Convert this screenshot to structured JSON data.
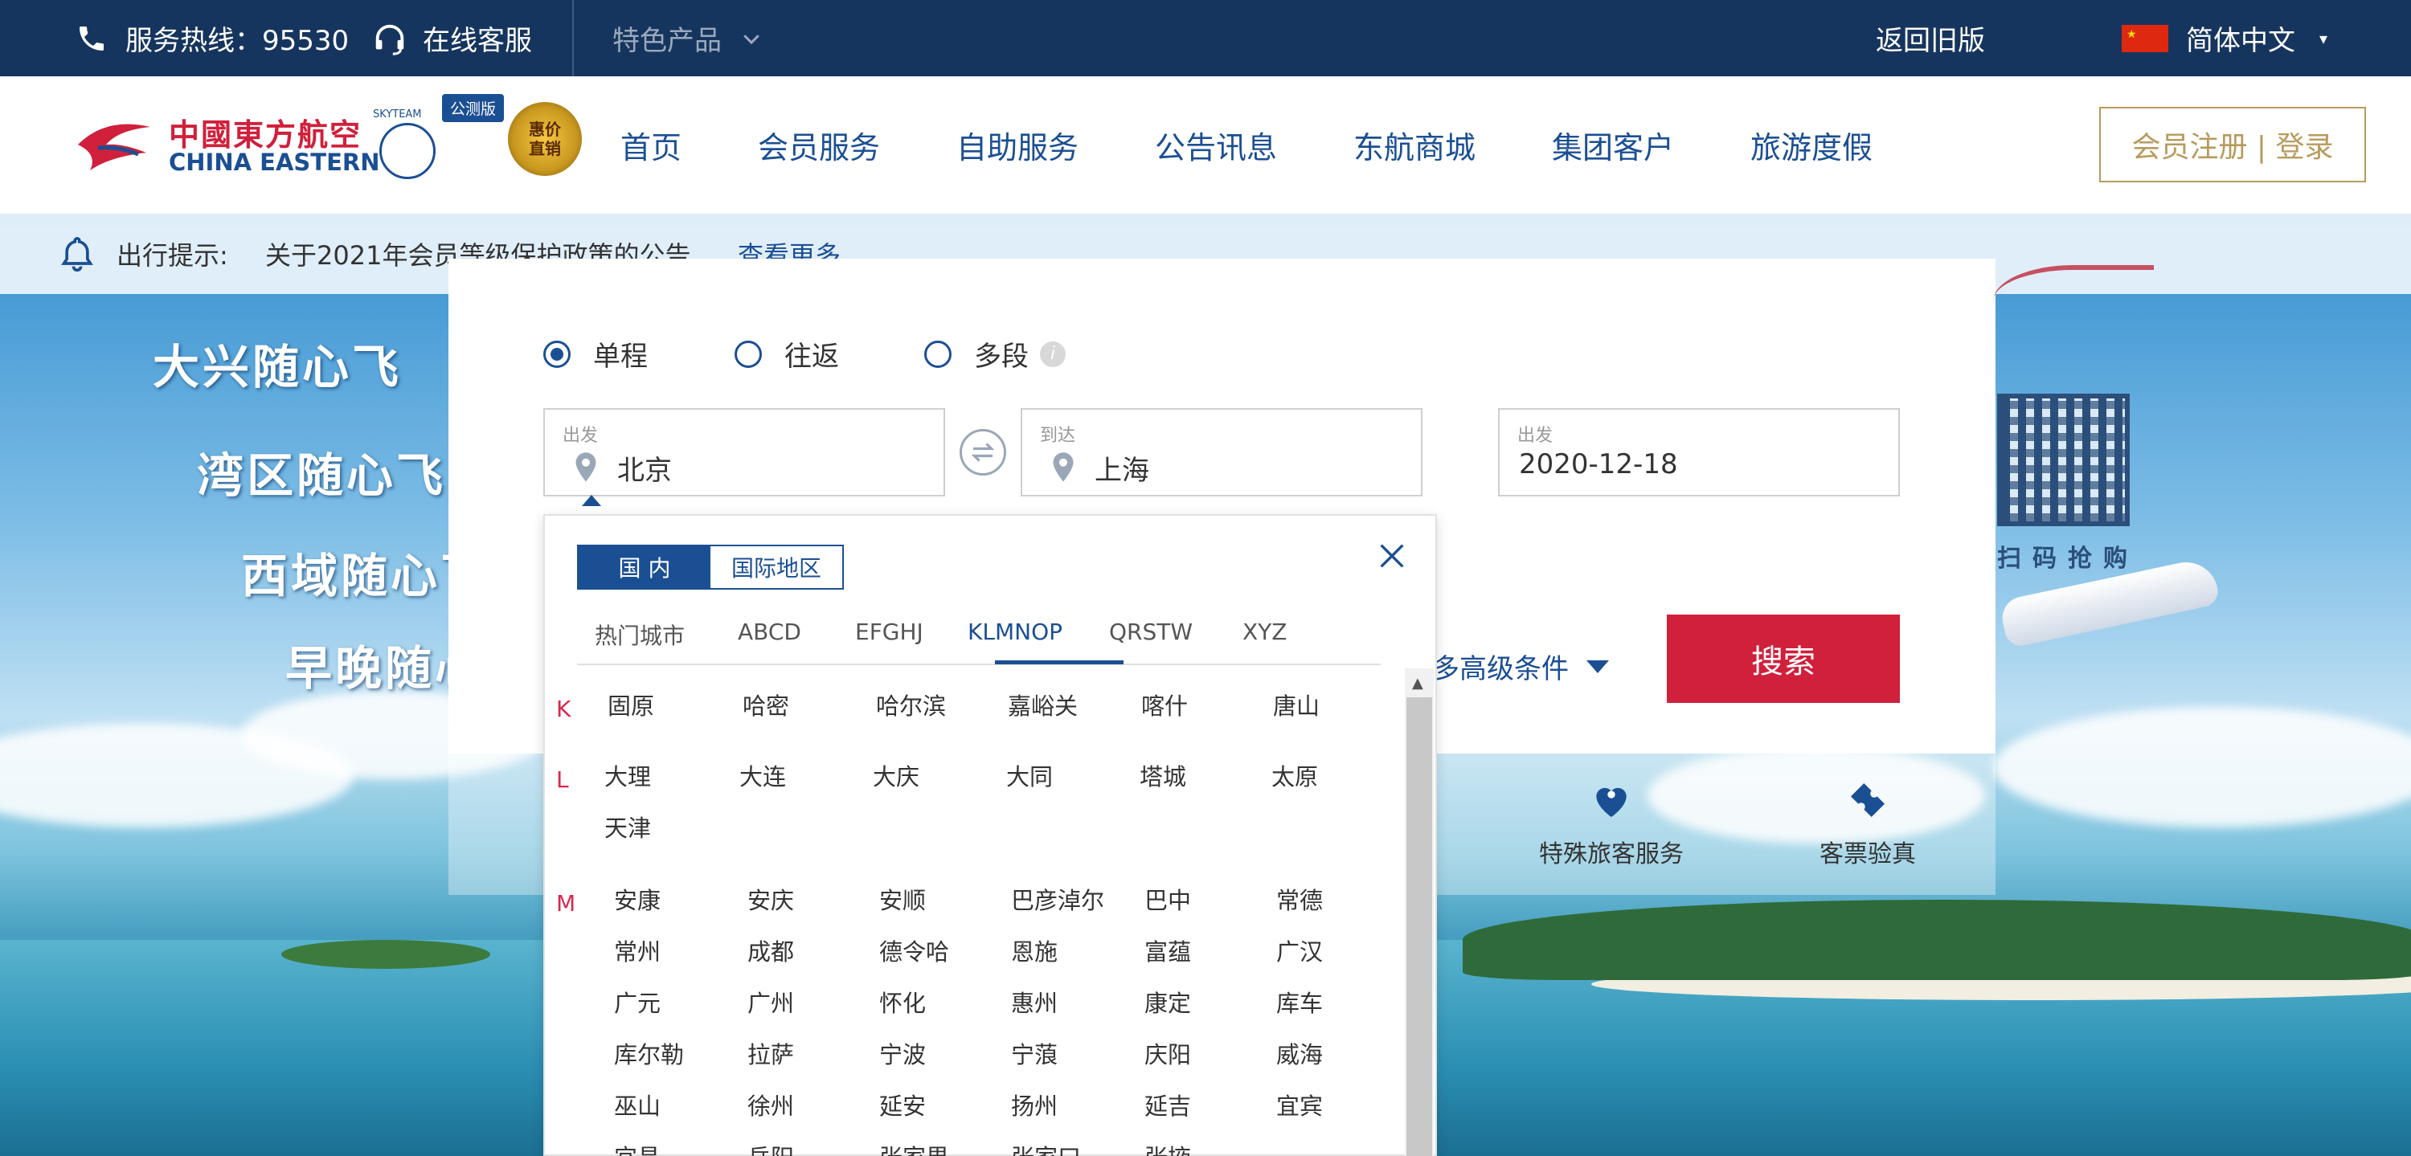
{
  "topbar": {
    "hotline": "服务热线：95530",
    "online_service": "在线客服",
    "featured": "特色产品",
    "old_version": "返回旧版",
    "language": "简体中文"
  },
  "nav": {
    "logo_cn": "中國東方航空",
    "logo_en": "CHINA EASTERN",
    "skyteam": "SKYTEAM",
    "beta_badge": "公测版",
    "promo_badge": "惠价直销",
    "items": [
      "首页",
      "会员服务",
      "自助服务",
      "公告讯息",
      "东航商城",
      "集团客户",
      "旅游度假"
    ],
    "login": "会员注册 | 登录"
  },
  "notice": {
    "label": "出行提示:",
    "text": "关于2021年会员等级保护政策的公告",
    "more": "查看更多"
  },
  "booking": {
    "trip_types": [
      "单程",
      "往返",
      "多段"
    ],
    "from": {
      "label": "出发",
      "value": "北京"
    },
    "to": {
      "label": "到达",
      "value": "上海"
    },
    "date": {
      "label": "出发",
      "value": "2020-12-18"
    },
    "more_conditions": "多高级条件",
    "search": "搜索"
  },
  "dropdown": {
    "tabs": [
      "国 内",
      "国际地区"
    ],
    "alpha_tabs": [
      "热门城市",
      "ABCD",
      "EFGHJ",
      "KLMNOP",
      "QRSTW",
      "XYZ"
    ],
    "active_alpha": "KLMNOP",
    "groups": [
      {
        "letter": "K",
        "cities": [
          "固原",
          "哈密",
          "哈尔滨",
          "嘉峪关",
          "喀什",
          "唐山"
        ]
      },
      {
        "letter": "L",
        "cities": [
          "大理",
          "大连",
          "大庆",
          "大同",
          "塔城",
          "太原",
          "天津"
        ]
      },
      {
        "letter": "M",
        "cities": [
          "安康",
          "安庆",
          "安顺",
          "巴彦淖尔",
          "巴中",
          "常德",
          "常州",
          "成都",
          "德令哈",
          "恩施",
          "富蕴",
          "广汉",
          "广元",
          "广州",
          "怀化",
          "惠州",
          "康定",
          "库车",
          "库尔勒",
          "拉萨",
          "宁波",
          "宁蒗",
          "庆阳",
          "威海",
          "巫山",
          "徐州",
          "延安",
          "扬州",
          "延吉",
          "宜宾",
          "宜昌",
          "岳阳",
          "张家界",
          "张家口",
          "张掖"
        ]
      }
    ]
  },
  "services": [
    {
      "label": "特殊旅客服务"
    },
    {
      "label": "客票验真"
    }
  ],
  "banner": {
    "routes": [
      "大兴随心飞",
      "湾区随心飞",
      "西域随心飞",
      "早晚随心飞"
    ],
    "qr_caption": "扫码抢购"
  },
  "colors": {
    "topbar": "#16355e",
    "brand_blue": "#1b4f93",
    "search_red": "#d0203b",
    "gold": "#b79b5d",
    "letter_red": "#d8284c"
  }
}
